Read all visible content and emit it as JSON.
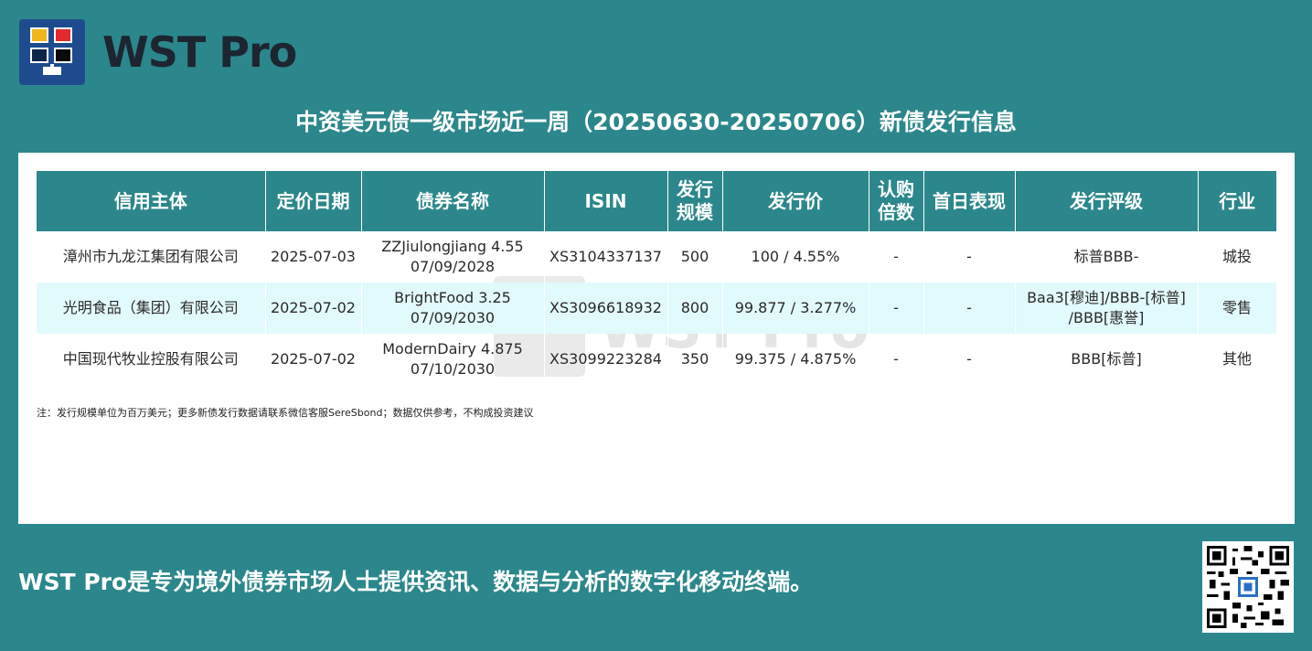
{
  "brand": {
    "name": "WST Pro"
  },
  "title": "中资美元债一级市场近一周（20250630-20250706）新债发行信息",
  "table": {
    "headers": [
      "信用主体",
      "定价日期",
      "债券名称",
      "ISIN",
      "发行\n规模",
      "发行价",
      "认购\n倍数",
      "首日表现",
      "发行评级",
      "行业"
    ],
    "rows": [
      [
        "漳州市九龙江集团有限公司",
        "2025-07-03",
        "ZZJiulongjiang 4.55\n07/09/2028",
        "XS3104337137",
        "500",
        "100 / 4.55%",
        "-",
        "-",
        "标普BBB-",
        "城投"
      ],
      [
        "光明食品（集团）有限公司",
        "2025-07-02",
        "BrightFood 3.25\n07/09/2030",
        "XS3096618932",
        "800",
        "99.877 / 3.277%",
        "-",
        "-",
        "Baa3[穆迪]/BBB-[标普]\n/BBB[惠誉]",
        "零售"
      ],
      [
        "中国现代牧业控股有限公司",
        "2025-07-02",
        "ModernDairy 4.875\n07/10/2030",
        "XS3099223284",
        "350",
        "99.375 / 4.875%",
        "-",
        "-",
        "BBB[标普]",
        "其他"
      ]
    ]
  },
  "note": "注：发行规模单位为百万美元；更多新债发行数据请联系微信客服SereSbond；数据仅供参考，不构成投资建议",
  "footer": "WST Pro是专为境外债券市场人士提供资讯、数据与分析的数字化移动终端。",
  "watermark": "WST Pro",
  "colors": {
    "background": "#2b878b",
    "header": "#2b878b",
    "alt_row": "#e1fafc"
  }
}
